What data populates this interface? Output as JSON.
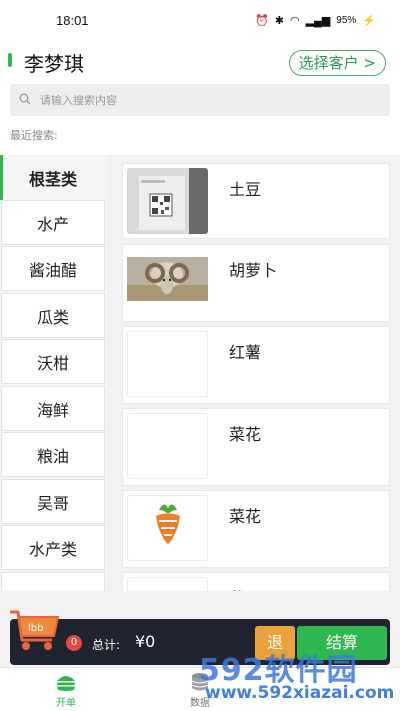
{
  "status_bar": {
    "time": "18:01",
    "battery": "95%"
  },
  "header": {
    "customer_name": "李梦琪",
    "select_customer": "选择客户 >"
  },
  "search": {
    "placeholder": "请输入搜索内容",
    "recent_label": "最近搜索:"
  },
  "categories": [
    {
      "label": "根茎类",
      "active": true
    },
    {
      "label": "水产"
    },
    {
      "label": "酱油醋"
    },
    {
      "label": "瓜类"
    },
    {
      "label": "沃柑"
    },
    {
      "label": "海鲜"
    },
    {
      "label": "粮油"
    },
    {
      "label": "吴哥"
    },
    {
      "label": "水产类"
    }
  ],
  "products": [
    {
      "name": "土豆",
      "image": "qr-code-photo"
    },
    {
      "name": "胡萝卜",
      "image": "ram-photo"
    },
    {
      "name": "红薯",
      "image": "blank"
    },
    {
      "name": "菜花",
      "image": "blank"
    },
    {
      "name": "菜花",
      "image": "carrot-logo"
    },
    {
      "name": "菜",
      "image": "partial"
    }
  ],
  "cart": {
    "count": "0",
    "total_label": "总计:",
    "total_value": "¥0",
    "return_label": "退",
    "checkout_label": "结算",
    "logo_text": "lbb"
  },
  "tabs": [
    {
      "label": "开单",
      "icon": "burger-icon",
      "active": true
    },
    {
      "label": "数据",
      "icon": "database-icon"
    }
  ],
  "watermark": {
    "brand": "592软件园",
    "url": "www.592xiazai.com"
  },
  "colors": {
    "accent": "#2eb84f",
    "cart_bar": "#1f2430",
    "return": "#e9a23b",
    "badge": "#e8463f"
  }
}
